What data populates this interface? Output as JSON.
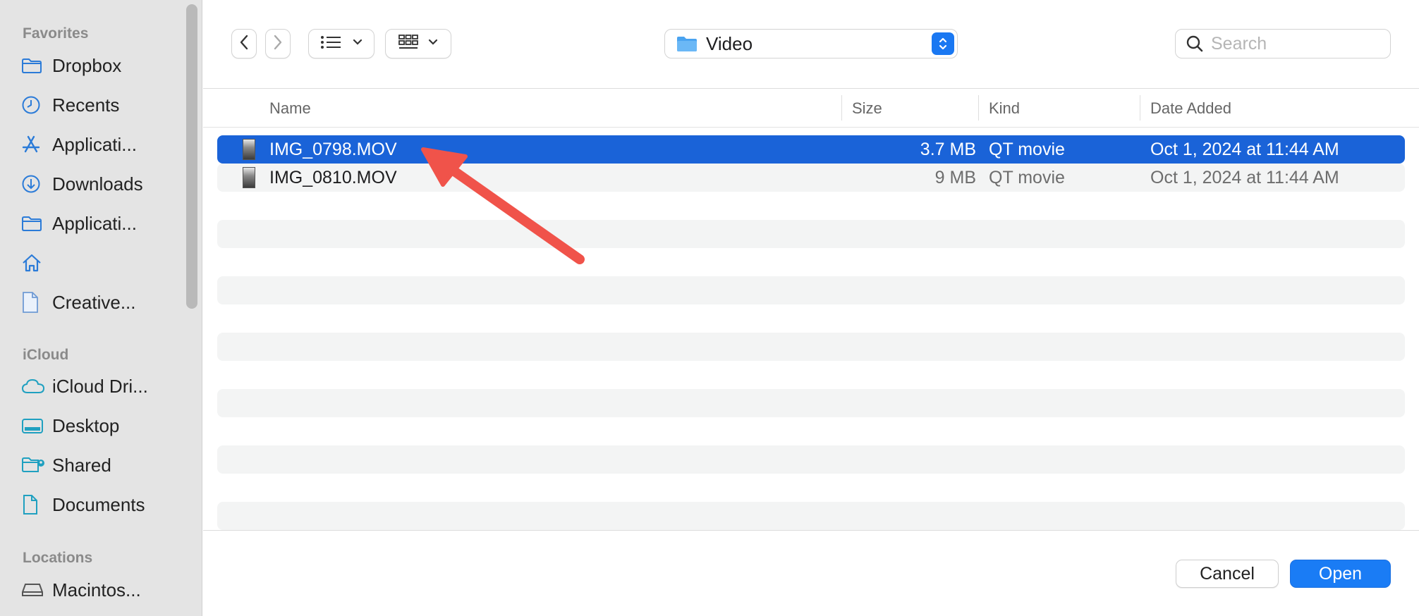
{
  "sidebar": {
    "favorites_heading": "Favorites",
    "favorites": [
      {
        "label": "Dropbox",
        "icon": "folder-icon"
      },
      {
        "label": "Recents",
        "icon": "clock-icon"
      },
      {
        "label": "Applicati...",
        "icon": "app-store-icon"
      },
      {
        "label": "Downloads",
        "icon": "download-icon"
      },
      {
        "label": "Applicati...",
        "icon": "folder-icon"
      },
      {
        "label": "",
        "icon": "home-icon"
      },
      {
        "label": "Creative...",
        "icon": "document-icon"
      }
    ],
    "icloud_heading": "iCloud",
    "icloud": [
      {
        "label": "iCloud Dri...",
        "icon": "cloud-icon"
      },
      {
        "label": "Desktop",
        "icon": "desktop-icon"
      },
      {
        "label": "Shared",
        "icon": "shared-folder-icon"
      },
      {
        "label": "Documents",
        "icon": "document-icon"
      }
    ],
    "locations_heading": "Locations",
    "locations": [
      {
        "label": "Macintos...",
        "icon": "disk-icon"
      }
    ]
  },
  "toolbar": {
    "back_icon": "chevron-left-icon",
    "forward_icon": "chevron-right-icon",
    "list_view_icon": "list-view-icon",
    "grid_view_icon": "grid-view-icon",
    "location": "Video",
    "search_placeholder": "Search"
  },
  "columns": {
    "name": "Name",
    "size": "Size",
    "kind": "Kind",
    "date_added": "Date Added"
  },
  "files": [
    {
      "name": "IMG_0798.MOV",
      "size": "3.7 MB",
      "kind": "QT movie",
      "date_added": "Oct 1, 2024 at 11:44 AM",
      "selected": true
    },
    {
      "name": "IMG_0810.MOV",
      "size": "9 MB",
      "kind": "QT movie",
      "date_added": "Oct 1, 2024 at 11:44 AM",
      "selected": false
    }
  ],
  "buttons": {
    "cancel": "Cancel",
    "open": "Open"
  },
  "colors": {
    "selection": "#1a63d8",
    "accent": "#1a7cf5",
    "annotation_arrow": "#f0534a",
    "sidebar_icon": "#2b7bd8"
  }
}
